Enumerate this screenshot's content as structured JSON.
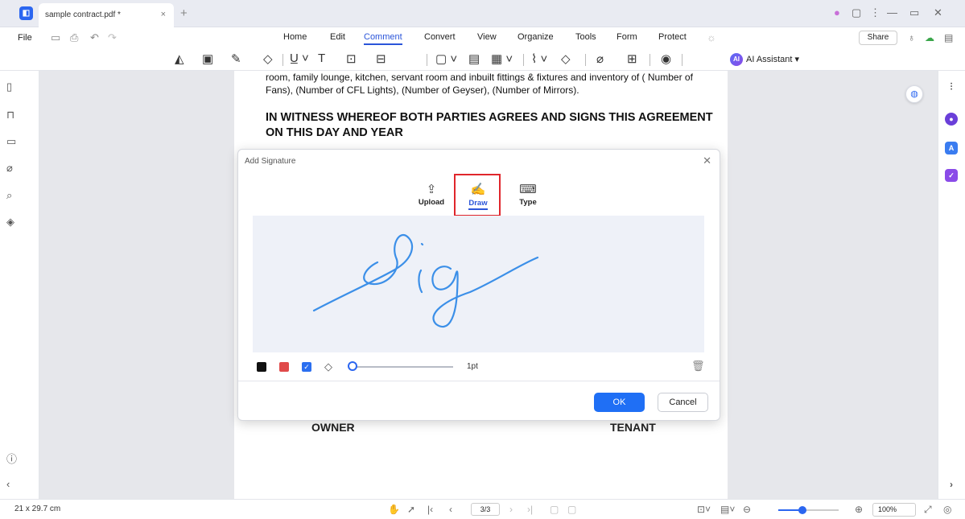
{
  "window": {
    "tab_title": "sample contract.pdf *",
    "tab_close": "×",
    "tab_add": "+",
    "controls": [
      "⋮",
      "—",
      "▭",
      "✕"
    ]
  },
  "menu": {
    "file": "File",
    "items": [
      "Home",
      "Edit",
      "Comment",
      "Convert",
      "View",
      "Organize",
      "Tools",
      "Form",
      "Protect"
    ],
    "active": "Comment",
    "share": "Share"
  },
  "toolbar": {
    "ai_badge": "AI",
    "ai_label": "AI Assistant ▾"
  },
  "document": {
    "paragraph": "room, family lounge, kitchen, servant room and inbuilt fittings & fixtures and inventory of ( Number of Fans), (Number of CFL Lights), (Number of Geyser), (Number of Mirrors).",
    "heading": "IN WITNESS WHEREOF BOTH PARTIES AGREES AND SIGNS THIS AGREEMENT ON THIS DAY AND YEAR",
    "owner": "OWNER",
    "tenant": "TENANT"
  },
  "dialog": {
    "title": "Add Signature",
    "close": "✕",
    "modes": [
      {
        "label": "Upload",
        "icon": "upload-icon"
      },
      {
        "label": "Draw",
        "icon": "draw-icon"
      },
      {
        "label": "Type",
        "icon": "keyboard-icon"
      }
    ],
    "active_mode": "Draw",
    "colors": [
      "#111111",
      "#e04a4a",
      "#2b6ff0"
    ],
    "selected_color": "#2b6ff0",
    "stroke_width_label": "1pt",
    "stroke_width_level": 0.0,
    "signature_stroke_color": "#3b8fe8",
    "ok": "OK",
    "cancel": "Cancel"
  },
  "statusbar": {
    "page_size": "21 x 29.7 cm",
    "page_indicator": "3/3",
    "zoom": "100%",
    "zoom_level": 0.4
  }
}
